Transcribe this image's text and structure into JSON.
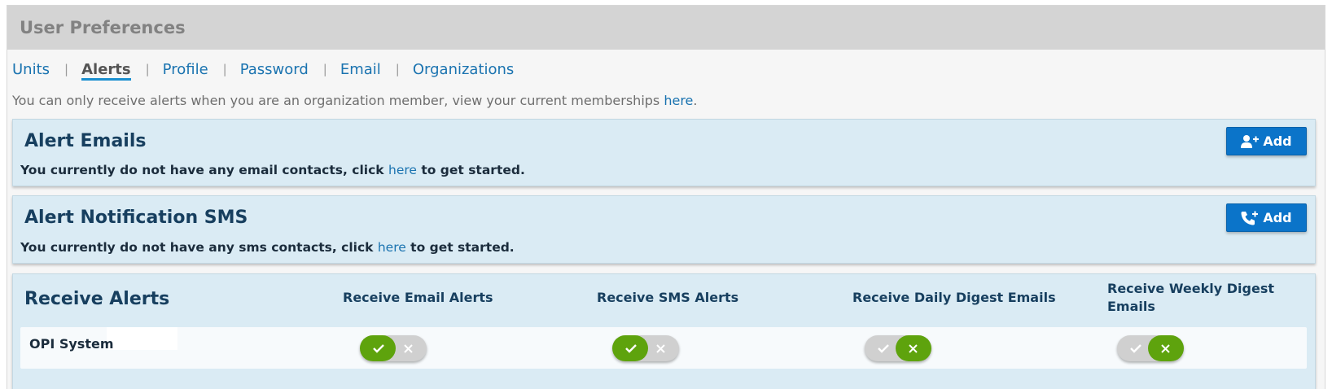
{
  "header": {
    "title": "User Preferences"
  },
  "tabs": [
    {
      "label": "Units"
    },
    {
      "label": "Alerts"
    },
    {
      "label": "Profile"
    },
    {
      "label": "Password"
    },
    {
      "label": "Email"
    },
    {
      "label": "Organizations"
    }
  ],
  "tab_separator": "|",
  "active_tab": "Alerts",
  "intro": {
    "text": "You can only receive alerts when you are an organization member, view your current memberships ",
    "link": "here",
    "suffix": "."
  },
  "alert_emails": {
    "title": "Alert Emails",
    "add_label": "Add",
    "add_icon": "user-plus-icon",
    "message_prefix": "You currently do not have any email contacts, click ",
    "message_link": "here",
    "message_suffix": " to get started."
  },
  "alert_sms": {
    "title": "Alert Notification SMS",
    "add_label": "Add",
    "add_icon": "phone-plus-icon",
    "message_prefix": "You currently do not have any sms contacts, click ",
    "message_link": "here",
    "message_suffix": " to get started."
  },
  "receive_alerts": {
    "title": "Receive Alerts",
    "columns": [
      {
        "label": "Receive Email Alerts"
      },
      {
        "label": "Receive SMS Alerts"
      },
      {
        "label": "Receive Daily Digest Emails"
      },
      {
        "label": "Receive Weekly Digest Emails"
      }
    ],
    "rows": [
      {
        "name": "OPI System",
        "toggles": [
          {
            "state": "on"
          },
          {
            "state": "on"
          },
          {
            "state": "off"
          },
          {
            "state": "off"
          }
        ]
      }
    ]
  },
  "colors": {
    "accent": "#0b74c9",
    "link": "#1a73b0",
    "toggle_active": "#5ea30d",
    "toggle_track": "#d0d0d0",
    "panel_bg": "#daebf4",
    "panel_title": "#173f5f"
  }
}
